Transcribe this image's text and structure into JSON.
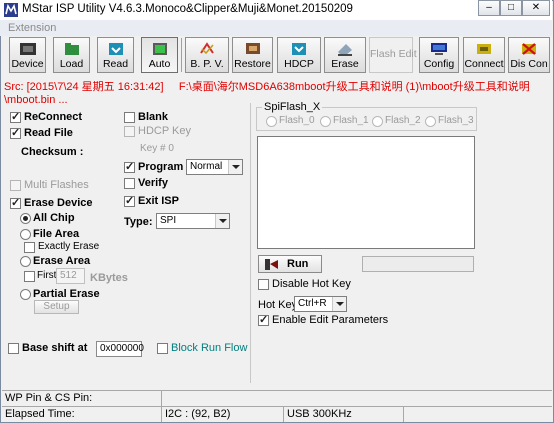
{
  "window": {
    "title": "MStar ISP Utility V4.6.3.Monoco&Clipper&Muji&Monet.20150209",
    "controls": [
      "–",
      "□",
      "✕"
    ]
  },
  "menu": {
    "extension": "Extension"
  },
  "toolbar": {
    "device": "Device",
    "load": "Load",
    "read": "Read",
    "auto": "Auto",
    "bpv": "B. P. V.",
    "restore": "Restore",
    "hdcp": "HDCP",
    "erase": "Erase",
    "flash_edit": "Flash Edit",
    "config": "Config",
    "connect": "Connect",
    "dis_con": "Dis Con"
  },
  "source": {
    "line1": "Src: [2015\\7\\24 星期五 16:31:42]     F:\\桌面\\海尔MSD6A638mboot升级工具和说明 (1)\\mboot升级工具和说明",
    "line2": "\\mboot.bin ..."
  },
  "options": {
    "reconnect": "ReConnect",
    "read_file": "Read File",
    "checksum": "Checksum :",
    "multi_flashes": "Multi Flashes",
    "erase_device": "Erase Device",
    "all_chip": "All Chip",
    "file_area": "File Area",
    "exactly_erase": "Exactly Erase",
    "erase_area": "Erase Area",
    "first": "First",
    "first_value": "512",
    "kbytes": "KBytes",
    "partial_erase": "Partial Erase",
    "setup": "Setup",
    "blank": "Blank",
    "hdcp_key": "HDCP Key",
    "key_no": "Key # 0",
    "program": "Program",
    "program_mode": "Normal",
    "verify": "Verify",
    "exit_isp": "Exit ISP",
    "type_label": "Type:",
    "type_value": "SPI",
    "base_shift": "Base shift at",
    "base_shift_value": "0x000000",
    "block_run_flow": "Block Run Flow"
  },
  "spiflash": {
    "title": "SpiFlash_X",
    "flash_0": "Flash_0",
    "flash_1": "Flash_1",
    "flash_2": "Flash_2",
    "flash_3": "Flash_3"
  },
  "run": {
    "button": "Run",
    "disable_hot_key": "Disable Hot Key",
    "hot_key_label": "Hot Key",
    "hot_key_value": "Ctrl+R",
    "enable_edit_parameters": "Enable Edit Parameters"
  },
  "status": {
    "wp_pin": "WP Pin & CS Pin:",
    "elapsed": "Elapsed Time:",
    "i2c": "I2C : (92, B2)",
    "usb": "USB  300KHz"
  },
  "colors": {
    "source_text": "#e00000",
    "block_run_flow": "#00807f",
    "disabled": "#9a9a9a"
  }
}
